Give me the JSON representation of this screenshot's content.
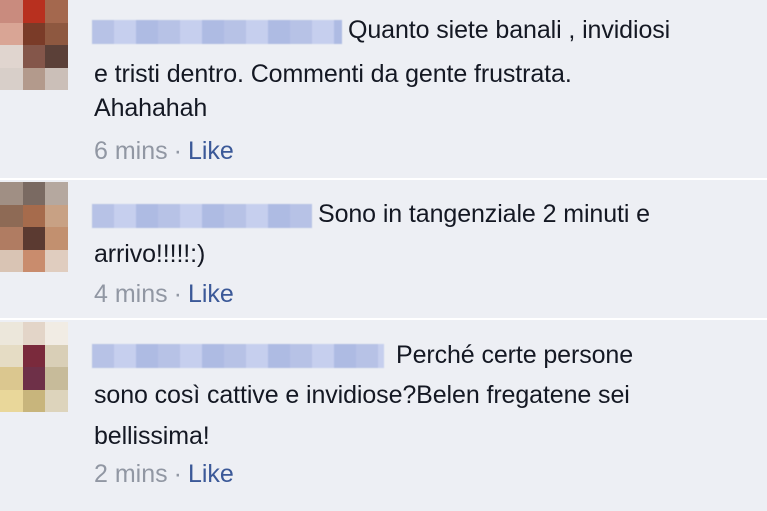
{
  "comments": [
    {
      "line1": "Quanto siete banali , invidiosi",
      "line2": "e tristi dentro. Commenti da gente frustrata.",
      "line3": "Ahahahah",
      "time": "6 mins",
      "separator": "·",
      "like": "Like",
      "avatar_colors": [
        "#c98b7e",
        "#b8301f",
        "#a4684e",
        "#d9a595",
        "#7a3b28",
        "#8e5840",
        "#e0d5cf",
        "#84564a",
        "#5b4038",
        "#d8cfc9",
        "#b39a8c",
        "#cbbfb8"
      ]
    },
    {
      "line1": "Sono in tangenziale 2 minuti e",
      "line2": "arrivo!!!!!:)",
      "time": "4 mins",
      "separator": "·",
      "like": "Like",
      "avatar_colors": [
        "#a08f84",
        "#7a6a62",
        "#b5a89f",
        "#8e6a55",
        "#a66b4c",
        "#c8a184",
        "#b07c62",
        "#5b3a31",
        "#c2906f",
        "#d9c4b4",
        "#c98c6d",
        "#e0cdbf"
      ]
    },
    {
      "line1": "Perché certe persone",
      "line2": "sono così cattive e invidiose?Belen fregatene sei",
      "line3": "bellissima!",
      "time": "2 mins",
      "separator": "·",
      "like": "Like",
      "avatar_colors": [
        "#ece7db",
        "#e3d5c8",
        "#f1ece4",
        "#e5dcc4",
        "#7a2a3c",
        "#d9cfb7",
        "#dbc78f",
        "#6e3048",
        "#c7bb9a",
        "#e9d79a",
        "#c8b57c",
        "#ddd4bc"
      ]
    }
  ]
}
